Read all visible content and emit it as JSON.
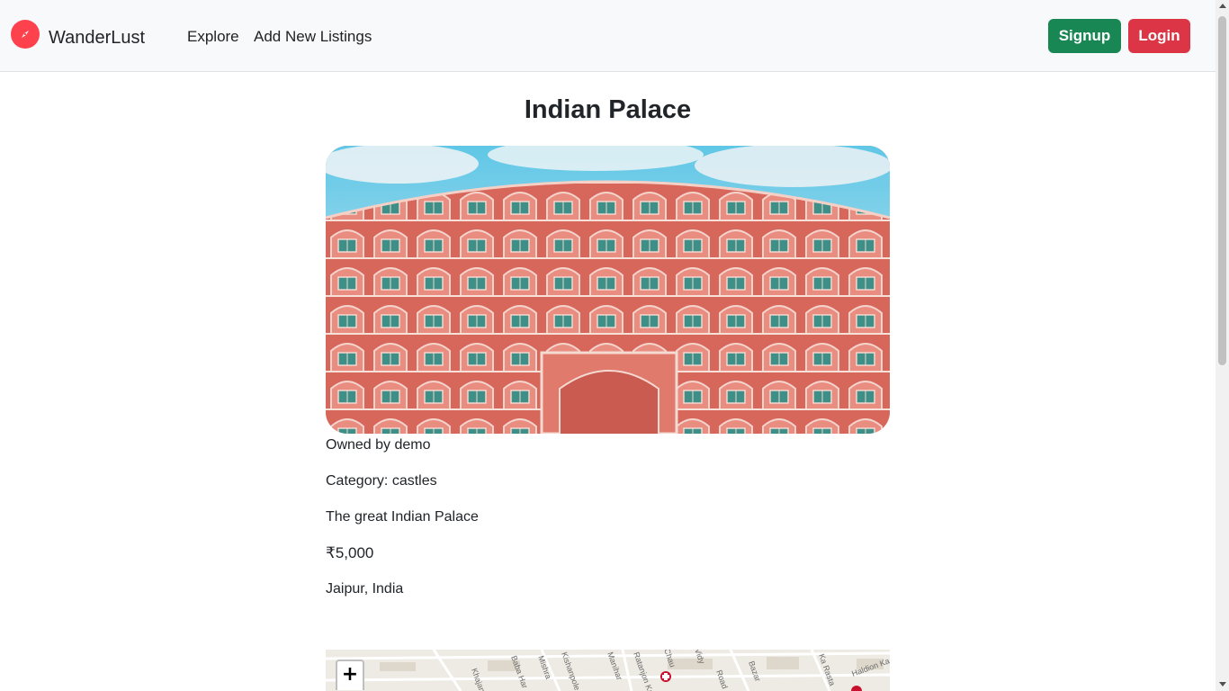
{
  "navbar": {
    "brand": "WanderLust",
    "brand_icon": "compass-icon",
    "links": [
      {
        "label": "Explore"
      },
      {
        "label": "Add New Listings"
      }
    ],
    "signup_label": "Signup",
    "login_label": "Login"
  },
  "listing": {
    "title": "Indian Palace",
    "image_alt": "Indian Palace",
    "owner": "Owned by demo",
    "category": "Category: castles",
    "description": "The great Indian Palace",
    "price": "₹5,000",
    "location": "Jaipur, India"
  },
  "map": {
    "zoom_in_label": "+",
    "labels": [
      "Khajane",
      "Baba Har",
      "Mishra",
      "Kishanpole",
      "Manihar",
      "Ratanjon Ka R",
      "Chau",
      "Vidy",
      "Road",
      "Bazar",
      "Ka Rasta",
      "Haldion Ka"
    ]
  },
  "colors": {
    "brand": "#fe424d",
    "signup": "#198754",
    "login": "#dc3545"
  }
}
